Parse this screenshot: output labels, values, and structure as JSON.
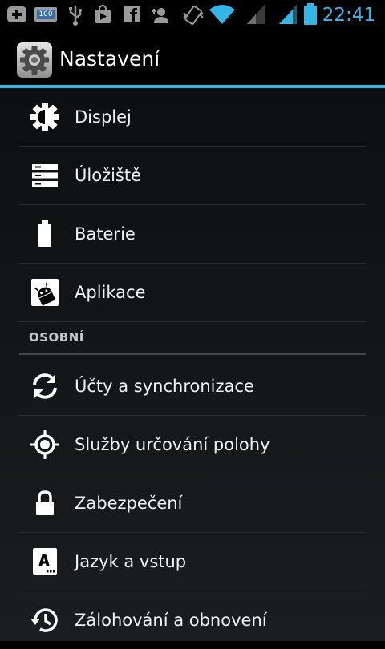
{
  "status_bar": {
    "time": "22:41",
    "badge": "100",
    "icons": [
      "add-icon",
      "notification-100-icon",
      "usb-icon",
      "play-store-icon",
      "facebook-icon",
      "add-contact-icon",
      "vibrate-icon",
      "wifi-icon",
      "signal-icon",
      "signal-icon",
      "battery-icon"
    ],
    "accent_color": "#33b5e5"
  },
  "action_bar": {
    "title": "Nastavení",
    "icon": "gear-icon"
  },
  "device_items": [
    {
      "label": "Displej",
      "icon": "brightness-icon"
    },
    {
      "label": "Úložiště",
      "icon": "storage-icon"
    },
    {
      "label": "Baterie",
      "icon": "battery-icon"
    },
    {
      "label": "Aplikace",
      "icon": "apps-icon"
    }
  ],
  "personal_section": {
    "header": "OSOBNÍ",
    "items": [
      {
        "label": "Účty a synchronizace",
        "icon": "sync-icon"
      },
      {
        "label": "Služby určování polohy",
        "icon": "location-icon"
      },
      {
        "label": "Zabezpečení",
        "icon": "lock-icon"
      },
      {
        "label": "Jazyk a vstup",
        "icon": "keyboard-language-icon"
      },
      {
        "label": "Zálohování a obnovení",
        "icon": "backup-restore-icon"
      }
    ]
  }
}
